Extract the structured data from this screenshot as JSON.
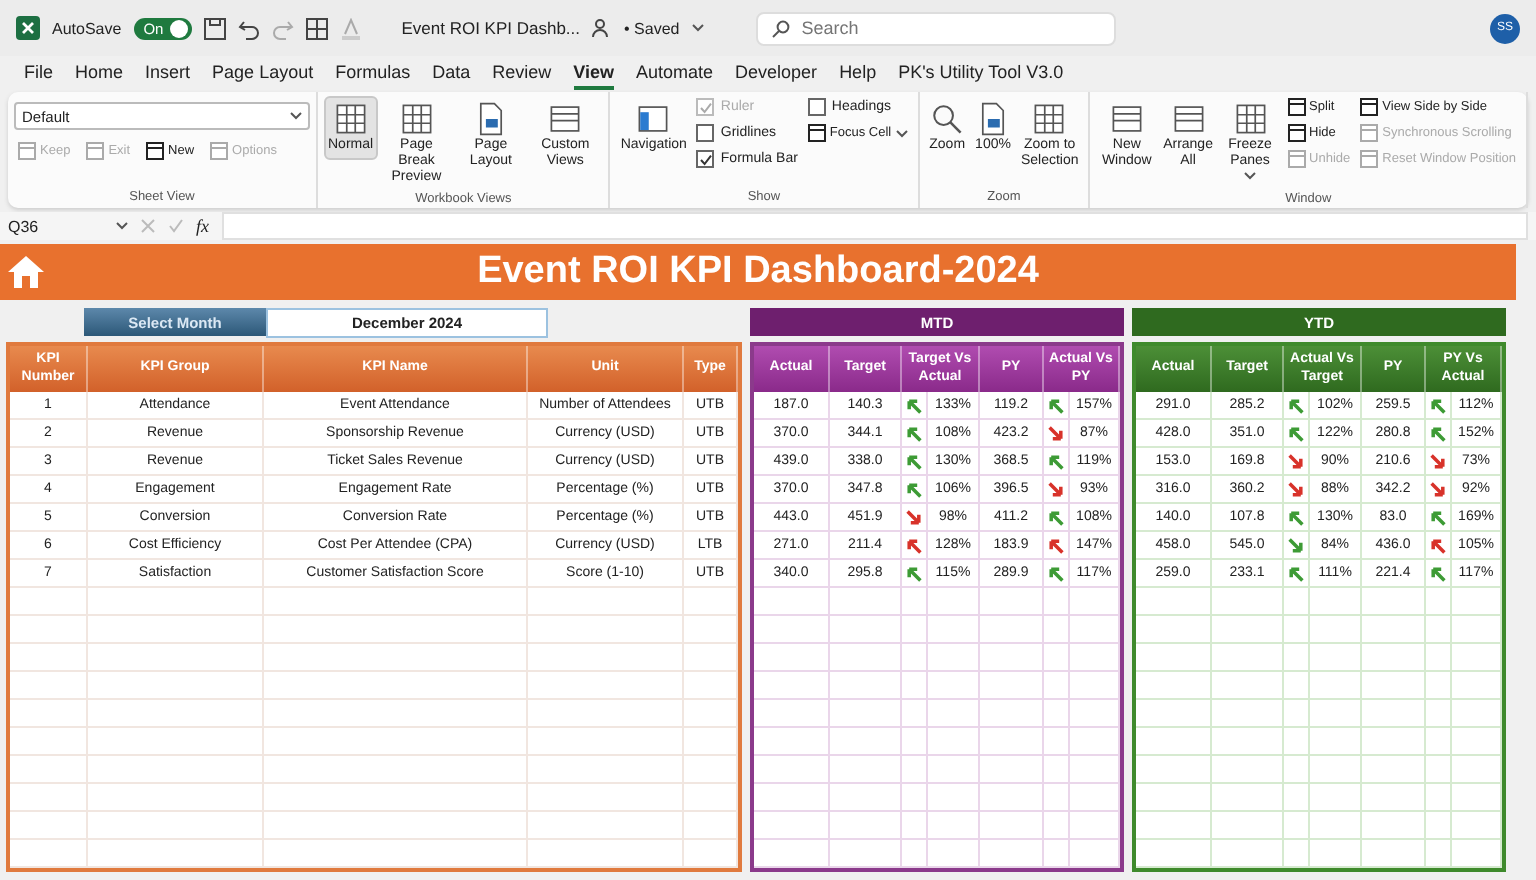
{
  "title_bar": {
    "autosave_label": "AutoSave",
    "autosave": {
      "label": "On",
      "on": true
    },
    "document_title": "Event ROI KPI Dashb...",
    "save_status": "• Saved",
    "search": {
      "placeholder": "Search"
    },
    "avatar": "SS"
  },
  "menu_tabs": [
    {
      "label": "File",
      "selected": false
    },
    {
      "label": "Home",
      "selected": false
    },
    {
      "label": "Insert",
      "selected": false
    },
    {
      "label": "Page Layout",
      "selected": false
    },
    {
      "label": "Formulas",
      "selected": false
    },
    {
      "label": "Data",
      "selected": false
    },
    {
      "label": "Review",
      "selected": false
    },
    {
      "label": "View",
      "selected": true
    },
    {
      "label": "Automate",
      "selected": false
    },
    {
      "label": "Developer",
      "selected": false
    },
    {
      "label": "Help",
      "selected": false
    },
    {
      "label": "PK's Utility Tool V3.0",
      "selected": false
    }
  ],
  "ribbon": {
    "groups": [
      {
        "label": "Sheet View",
        "columns": [
          {
            "items": [
              {
                "kind": "select",
                "value": "Default"
              },
              {
                "kind": "row",
                "items": [
                  {
                    "kind": "small",
                    "label": "Keep",
                    "disabled": true
                  },
                  {
                    "kind": "small",
                    "label": "Exit",
                    "disabled": true
                  },
                  {
                    "kind": "small",
                    "label": "New",
                    "disabled": false
                  },
                  {
                    "kind": "small",
                    "label": "Options",
                    "disabled": true
                  }
                ]
              }
            ]
          }
        ]
      },
      {
        "label": "Workbook Views",
        "columns": [
          {
            "items": [
              {
                "kind": "large",
                "label": "Normal",
                "selected": true
              }
            ]
          },
          {
            "items": [
              {
                "kind": "large",
                "label": "Page Break Preview",
                "selected": false
              }
            ]
          },
          {
            "items": [
              {
                "kind": "large",
                "label": "Page Layout",
                "selected": false
              }
            ]
          },
          {
            "items": [
              {
                "kind": "large",
                "label": "Custom Views",
                "selected": false
              }
            ]
          }
        ]
      },
      {
        "label": "Show",
        "columns": [
          {
            "items": [
              {
                "kind": "large",
                "label": "Navigation",
                "selected": false
              }
            ]
          },
          {
            "items": [
              {
                "kind": "check",
                "label": "Ruler",
                "checked": true,
                "disabled": true
              },
              {
                "kind": "check",
                "label": "Gridlines",
                "checked": false,
                "disabled": false
              },
              {
                "kind": "check",
                "label": "Formula Bar",
                "checked": true,
                "disabled": false
              }
            ]
          },
          {
            "items": [
              {
                "kind": "check",
                "label": "Headings",
                "checked": false,
                "disabled": false
              },
              {
                "kind": "small",
                "label": "Focus Cell",
                "disabled": false,
                "caret": true
              }
            ]
          }
        ]
      },
      {
        "label": "Zoom",
        "columns": [
          {
            "items": [
              {
                "kind": "large",
                "label": "Zoom",
                "selected": false
              }
            ]
          },
          {
            "items": [
              {
                "kind": "large",
                "label": "100%",
                "selected": false
              }
            ]
          },
          {
            "items": [
              {
                "kind": "large",
                "label": "Zoom to Selection",
                "selected": false
              }
            ]
          }
        ]
      },
      {
        "label": "Window",
        "columns": [
          {
            "items": [
              {
                "kind": "large",
                "label": "New Window",
                "selected": false
              }
            ]
          },
          {
            "items": [
              {
                "kind": "large",
                "label": "Arrange All",
                "selected": false
              }
            ]
          },
          {
            "items": [
              {
                "kind": "large",
                "label": "Freeze Panes",
                "selected": false,
                "caret": true
              }
            ]
          },
          {
            "items": [
              {
                "kind": "small",
                "label": "Split",
                "disabled": false
              },
              {
                "kind": "small",
                "label": "Hide",
                "disabled": false
              },
              {
                "kind": "small",
                "label": "Unhide",
                "disabled": true
              }
            ]
          },
          {
            "items": [
              {
                "kind": "small",
                "label": "View Side by Side",
                "disabled": false
              },
              {
                "kind": "small",
                "label": "Synchronous Scrolling",
                "disabled": true
              },
              {
                "kind": "small",
                "label": "Reset Window Position",
                "disabled": true
              }
            ]
          }
        ]
      }
    ]
  },
  "formula_bar": {
    "name_box": "Q36",
    "fx": "fx"
  },
  "sheet": {
    "banner_title": "Event ROI KPI Dashboard-2024",
    "month_label": "Select Month",
    "month_value": "December 2024",
    "kpi_table": {
      "columns": [
        "KPI Number",
        "KPI Group",
        "KPI Name",
        "Unit",
        "Type"
      ],
      "rows": [
        [
          "1",
          "Attendance",
          "Event Attendance",
          "Number of Attendees",
          "UTB"
        ],
        [
          "2",
          "Revenue",
          "Sponsorship Revenue",
          "Currency (USD)",
          "UTB"
        ],
        [
          "3",
          "Revenue",
          "Ticket Sales Revenue",
          "Currency (USD)",
          "UTB"
        ],
        [
          "4",
          "Engagement",
          "Engagement Rate",
          "Percentage (%)",
          "UTB"
        ],
        [
          "5",
          "Conversion",
          "Conversion Rate",
          "Percentage (%)",
          "UTB"
        ],
        [
          "6",
          "Cost Efficiency",
          "Cost Per Attendee (CPA)",
          "Currency (USD)",
          "LTB"
        ],
        [
          "7",
          "Satisfaction",
          "Customer Satisfaction Score",
          "Score (1-10)",
          "UTB"
        ]
      ]
    },
    "sections": [
      {
        "kind": "mtd",
        "title": "MTD",
        "columns": [
          "Actual",
          "Target",
          "Target Vs Actual",
          "PY",
          "Actual Vs PY"
        ],
        "rows": [
          {
            "actual": "187.0",
            "target": "140.3",
            "vs_target": {
              "rising": true,
              "color": "#3d9b35",
              "pct": "133%"
            },
            "py": "119.2",
            "vs_py": {
              "rising": true,
              "color": "#3d9b35",
              "pct": "157%"
            }
          },
          {
            "actual": "370.0",
            "target": "344.1",
            "vs_target": {
              "rising": true,
              "color": "#3d9b35",
              "pct": "108%"
            },
            "py": "423.2",
            "vs_py": {
              "rising": false,
              "color": "#d8322a",
              "pct": "87%"
            }
          },
          {
            "actual": "439.0",
            "target": "338.0",
            "vs_target": {
              "rising": true,
              "color": "#3d9b35",
              "pct": "130%"
            },
            "py": "368.5",
            "vs_py": {
              "rising": true,
              "color": "#3d9b35",
              "pct": "119%"
            }
          },
          {
            "actual": "370.0",
            "target": "347.8",
            "vs_target": {
              "rising": true,
              "color": "#3d9b35",
              "pct": "106%"
            },
            "py": "396.5",
            "vs_py": {
              "rising": false,
              "color": "#d8322a",
              "pct": "93%"
            }
          },
          {
            "actual": "443.0",
            "target": "451.9",
            "vs_target": {
              "rising": false,
              "color": "#d8322a",
              "pct": "98%"
            },
            "py": "411.2",
            "vs_py": {
              "rising": true,
              "color": "#3d9b35",
              "pct": "108%"
            }
          },
          {
            "actual": "271.0",
            "target": "211.4",
            "vs_target": {
              "rising": true,
              "color": "#d8322a",
              "pct": "128%"
            },
            "py": "183.9",
            "vs_py": {
              "rising": true,
              "color": "#d8322a",
              "pct": "147%"
            }
          },
          {
            "actual": "340.0",
            "target": "295.8",
            "vs_target": {
              "rising": true,
              "color": "#3d9b35",
              "pct": "115%"
            },
            "py": "289.9",
            "vs_py": {
              "rising": true,
              "color": "#3d9b35",
              "pct": "117%"
            }
          }
        ]
      },
      {
        "kind": "ytd",
        "title": "YTD",
        "columns": [
          "Actual",
          "Target",
          "Actual Vs Target",
          "PY",
          "PY Vs Actual"
        ],
        "rows": [
          {
            "actual": "291.0",
            "target": "285.2",
            "vs_target": {
              "rising": true,
              "color": "#3d9b35",
              "pct": "102%"
            },
            "py": "259.5",
            "vs_py": {
              "rising": true,
              "color": "#3d9b35",
              "pct": "112%"
            }
          },
          {
            "actual": "428.0",
            "target": "351.0",
            "vs_target": {
              "rising": true,
              "color": "#3d9b35",
              "pct": "122%"
            },
            "py": "280.8",
            "vs_py": {
              "rising": true,
              "color": "#3d9b35",
              "pct": "152%"
            }
          },
          {
            "actual": "153.0",
            "target": "169.8",
            "vs_target": {
              "rising": false,
              "color": "#d8322a",
              "pct": "90%"
            },
            "py": "210.6",
            "vs_py": {
              "rising": false,
              "color": "#d8322a",
              "pct": "73%"
            }
          },
          {
            "actual": "316.0",
            "target": "360.2",
            "vs_target": {
              "rising": false,
              "color": "#d8322a",
              "pct": "88%"
            },
            "py": "342.2",
            "vs_py": {
              "rising": false,
              "color": "#d8322a",
              "pct": "92%"
            }
          },
          {
            "actual": "140.0",
            "target": "107.8",
            "vs_target": {
              "rising": true,
              "color": "#3d9b35",
              "pct": "130%"
            },
            "py": "83.0",
            "vs_py": {
              "rising": true,
              "color": "#3d9b35",
              "pct": "169%"
            }
          },
          {
            "actual": "458.0",
            "target": "545.0",
            "vs_target": {
              "rising": false,
              "color": "#3d9b35",
              "pct": "84%"
            },
            "py": "436.0",
            "vs_py": {
              "rising": true,
              "color": "#d8322a",
              "pct": "105%"
            }
          },
          {
            "actual": "259.0",
            "target": "233.1",
            "vs_target": {
              "rising": true,
              "color": "#3d9b35",
              "pct": "111%"
            },
            "py": "221.4",
            "vs_py": {
              "rising": true,
              "color": "#3d9b35",
              "pct": "117%"
            }
          }
        ]
      }
    ]
  }
}
